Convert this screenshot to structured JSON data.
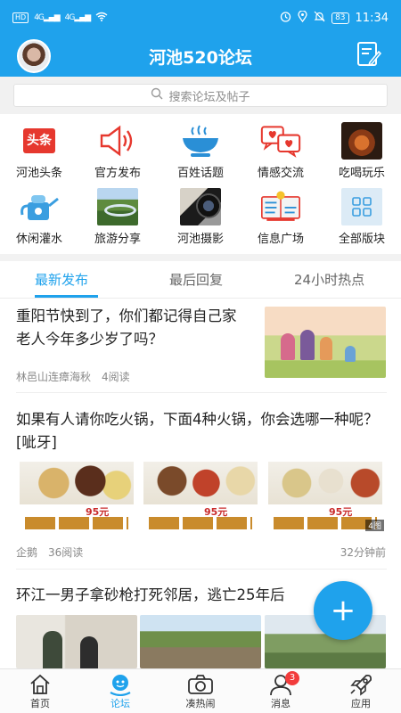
{
  "status_bar": {
    "hd_label": "HD",
    "signal_1": "4G",
    "signal_2": "4G",
    "battery": "83",
    "time": "11:34"
  },
  "header": {
    "title": "河池520论坛"
  },
  "search": {
    "placeholder": "搜索论坛及帖子"
  },
  "categories": [
    {
      "label": "河池头条",
      "icon": "headline-icon"
    },
    {
      "label": "官方发布",
      "icon": "megaphone-icon"
    },
    {
      "label": "百姓话题",
      "icon": "bowl-icon"
    },
    {
      "label": "情感交流",
      "icon": "heart-chat-icon"
    },
    {
      "label": "吃喝玩乐",
      "icon": "food-icon"
    },
    {
      "label": "休闲灌水",
      "icon": "watering-can-icon"
    },
    {
      "label": "旅游分享",
      "icon": "landscape-icon"
    },
    {
      "label": "河池摄影",
      "icon": "camera-lens-icon"
    },
    {
      "label": "信息广场",
      "icon": "info-board-icon"
    },
    {
      "label": "全部版块",
      "icon": "grid-icon"
    }
  ],
  "headline_icon_text": "头条",
  "tabs": [
    {
      "label": "最新发布",
      "active": true
    },
    {
      "label": "最后回复",
      "active": false
    },
    {
      "label": "24小时热点",
      "active": false
    }
  ],
  "posts": [
    {
      "title": "重阳节快到了，你们都记得自己家老人今年多少岁了吗？",
      "author": "林邑山连瘴海秋",
      "reads": "4阅读"
    },
    {
      "title": "如果有人请你吃火锅，下面4种火锅，你会选哪一种呢？[呲牙]",
      "author": "企鹅",
      "reads": "36阅读",
      "time": "32分钟前",
      "image_count": "4图",
      "hotpot_prices": [
        "95元",
        "95元",
        "95元"
      ]
    },
    {
      "title": "环江一男子拿砂枪打死邻居，逃亡25年后"
    }
  ],
  "fab": {
    "label": "+"
  },
  "bottom_nav": [
    {
      "label": "首页",
      "icon": "home-icon",
      "active": false
    },
    {
      "label": "论坛",
      "icon": "forum-icon",
      "active": true
    },
    {
      "label": "凑热闹",
      "icon": "camera-icon",
      "active": false
    },
    {
      "label": "消息",
      "icon": "user-message-icon",
      "active": false,
      "badge": "3"
    },
    {
      "label": "应用",
      "icon": "rocket-icon",
      "active": false
    }
  ],
  "colors": {
    "brand": "#1fa2ec",
    "badge": "#f23c3c"
  }
}
